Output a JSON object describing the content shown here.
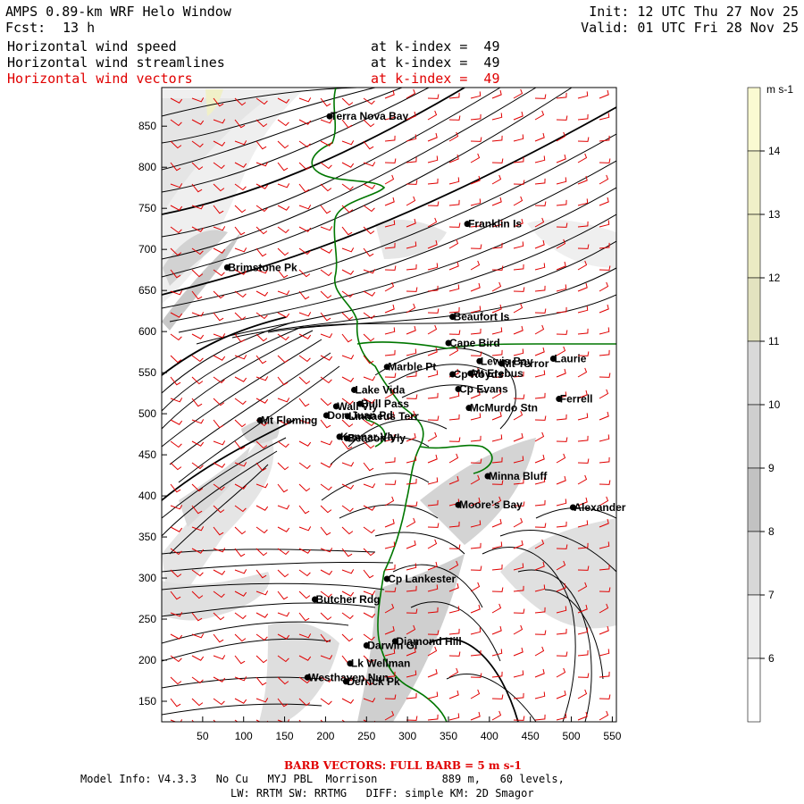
{
  "header": {
    "title": "AMPS 0.89-km WRF Helo Window",
    "fcst_label": "Fcst:",
    "fcst_value": "13 h",
    "init": "Init: 12 UTC Thu 27 Nov 25",
    "valid": "Valid: 01 UTC Fri 28 Nov 25",
    "fields": [
      {
        "name": "Horizontal wind speed",
        "level": "at k-index =  49",
        "color": "#000000"
      },
      {
        "name": "Horizontal wind streamlines",
        "level": "at k-index =  49",
        "color": "#000000"
      },
      {
        "name": "Horizontal wind vectors",
        "level": "at k-index =  49",
        "color": "#e00000"
      }
    ]
  },
  "axes": {
    "x_ticks": [
      "50",
      "100",
      "150",
      "200",
      "250",
      "300",
      "350",
      "400",
      "450",
      "500",
      "550"
    ],
    "y_ticks": [
      "850",
      "800",
      "750",
      "700",
      "650",
      "600",
      "550",
      "500",
      "450",
      "400",
      "350",
      "300",
      "250",
      "200",
      "150"
    ],
    "x_range": [
      0,
      555
    ],
    "y_range": [
      125,
      897
    ]
  },
  "colorbar": {
    "unit": "m s-1",
    "labels": [
      "14",
      "13",
      "12",
      "11",
      "10",
      "9",
      "8",
      "7",
      "6"
    ],
    "colors": [
      "#fafad2",
      "#f0f0c8",
      "#ebebc3",
      "#e3e3c0",
      "#d9d9d9",
      "#cfcfcf",
      "#c2c2c2",
      "#d7d7d7",
      "#ececec",
      "#ffffff"
    ]
  },
  "places": [
    {
      "name": "Terra Nova Bay",
      "x": 205,
      "y": 862
    },
    {
      "name": "Franklin Is",
      "x": 373,
      "y": 731
    },
    {
      "name": "Brimstone Pk",
      "x": 80,
      "y": 678
    },
    {
      "name": "Beaufort Is",
      "x": 355,
      "y": 618
    },
    {
      "name": "Cape Bird",
      "x": 350,
      "y": 586
    },
    {
      "name": "Lewis Bay",
      "x": 388,
      "y": 564
    },
    {
      "name": "Laurie",
      "x": 478,
      "y": 567
    },
    {
      "name": "Mt Terror",
      "x": 415,
      "y": 561
    },
    {
      "name": "Marble Pt",
      "x": 275,
      "y": 557
    },
    {
      "name": "Cp Royds",
      "x": 355,
      "y": 548
    },
    {
      "name": "Mt Erebus",
      "x": 377,
      "y": 549
    },
    {
      "name": "Lake Vida",
      "x": 235,
      "y": 529
    },
    {
      "name": "Cp Evans",
      "x": 362,
      "y": 530
    },
    {
      "name": "Ferrell",
      "x": 485,
      "y": 518
    },
    {
      "name": "Wall Vly",
      "x": 213,
      "y": 509
    },
    {
      "name": "Bull Pass",
      "x": 242,
      "y": 512
    },
    {
      "name": "McMurdo Stn",
      "x": 375,
      "y": 507
    },
    {
      "name": "Don Juan Pd",
      "x": 201,
      "y": 498
    },
    {
      "name": "Linnaeus Terr",
      "x": 227,
      "y": 497
    },
    {
      "name": "Mt Fleming",
      "x": 120,
      "y": 492
    },
    {
      "name": "Kennar Vly",
      "x": 217,
      "y": 472
    },
    {
      "name": "Beacon Vly",
      "x": 226,
      "y": 470
    },
    {
      "name": "Minna Bluff",
      "x": 398,
      "y": 424
    },
    {
      "name": "Moore's Bay",
      "x": 362,
      "y": 389
    },
    {
      "name": "Alexander",
      "x": 502,
      "y": 386
    },
    {
      "name": "Cp Lankester",
      "x": 275,
      "y": 299
    },
    {
      "name": "Butcher Rdg",
      "x": 187,
      "y": 274
    },
    {
      "name": "Darwin Gl",
      "x": 250,
      "y": 218
    },
    {
      "name": "Diamond Hill",
      "x": 285,
      "y": 223
    },
    {
      "name": "Lk Wellman",
      "x": 230,
      "y": 196
    },
    {
      "name": "Westhaven Nun",
      "x": 178,
      "y": 179
    },
    {
      "name": "Derrick Pk",
      "x": 225,
      "y": 174
    }
  ],
  "barb_note": "BARB VECTORS:  FULL BARB = 5 m s-1",
  "model_info": {
    "line1": "Model Info: V4.3.3   No Cu   MYJ PBL  Morrison          889 m,   60 levels,",
    "line2": "LW: RRTM SW: RRTMG   DIFF: simple KM: 2D Smagor"
  }
}
